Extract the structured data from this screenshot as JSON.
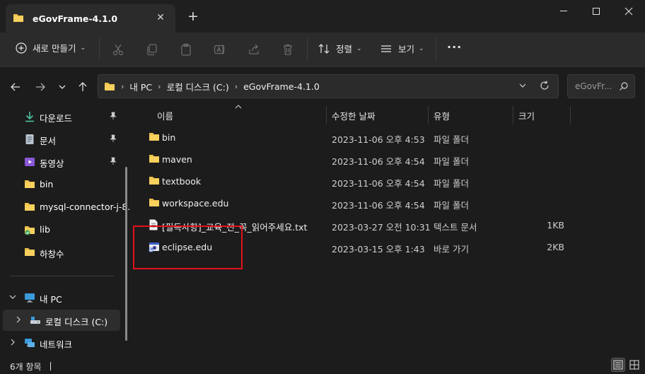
{
  "window": {
    "tab_title": "eGovFrame-4.1.0",
    "close_tab": "✕",
    "new_tab": "+",
    "minimize": "—",
    "maximize": "☐",
    "close": "✕"
  },
  "toolbar": {
    "new_label": "새로 만들기",
    "sort_label": "정렬",
    "view_label": "보기",
    "more": "···"
  },
  "address": {
    "crumbs": [
      "내 PC",
      "로컬 디스크 (C:)",
      "eGovFrame-4.1.0"
    ],
    "search_placeholder": "eGovFr..."
  },
  "sidebar": {
    "items": [
      {
        "label": "다운로드",
        "icon": "download-icon",
        "pinned": true
      },
      {
        "label": "문서",
        "icon": "document-icon",
        "pinned": true
      },
      {
        "label": "동영상",
        "icon": "video-icon",
        "pinned": true
      },
      {
        "label": "bin",
        "icon": "folder-icon",
        "pinned": false
      },
      {
        "label": "mysql-connector-j-8.",
        "icon": "folder-icon",
        "pinned": false
      },
      {
        "label": "lib",
        "icon": "folder-icon",
        "pinned": false
      },
      {
        "label": "하창수",
        "icon": "folder-icon",
        "pinned": false
      }
    ],
    "tree": [
      {
        "label": "내 PC",
        "icon": "pc-icon",
        "expanded": true
      },
      {
        "label": "로컬 디스크 (C:)",
        "icon": "drive-icon",
        "expanded": false
      },
      {
        "label": "네트워크",
        "icon": "network-icon",
        "expanded": false
      }
    ]
  },
  "columns": {
    "name": "이름",
    "modified": "수정한 날짜",
    "type": "유형",
    "size": "크기"
  },
  "files": [
    {
      "name": "bin",
      "modified": "2023-11-06 오후 4:53",
      "type": "파일 폴더",
      "size": "",
      "icon": "folder-icon"
    },
    {
      "name": "maven",
      "modified": "2023-11-06 오후 4:54",
      "type": "파일 폴더",
      "size": "",
      "icon": "folder-icon"
    },
    {
      "name": "textbook",
      "modified": "2023-11-06 오후 4:54",
      "type": "파일 폴더",
      "size": "",
      "icon": "folder-icon"
    },
    {
      "name": "workspace.edu",
      "modified": "2023-11-06 오후 4:54",
      "type": "파일 폴더",
      "size": "",
      "icon": "folder-icon"
    },
    {
      "name": "[필독사항]_교육_전_꼭_읽어주세요.txt",
      "modified": "2023-03-27 오전 10:31",
      "type": "텍스트 문서",
      "size": "1KB",
      "icon": "text-file-icon"
    },
    {
      "name": "eclipse.edu",
      "modified": "2023-03-15 오후 1:43",
      "type": "바로 가기",
      "size": "2KB",
      "icon": "shortcut-icon"
    }
  ],
  "status": {
    "item_count": "6개 항목"
  },
  "colors": {
    "folder": "#f0c24b",
    "highlight": "#e3121b",
    "background": "#1c1c1c",
    "toolbar": "#2b2b2b"
  }
}
